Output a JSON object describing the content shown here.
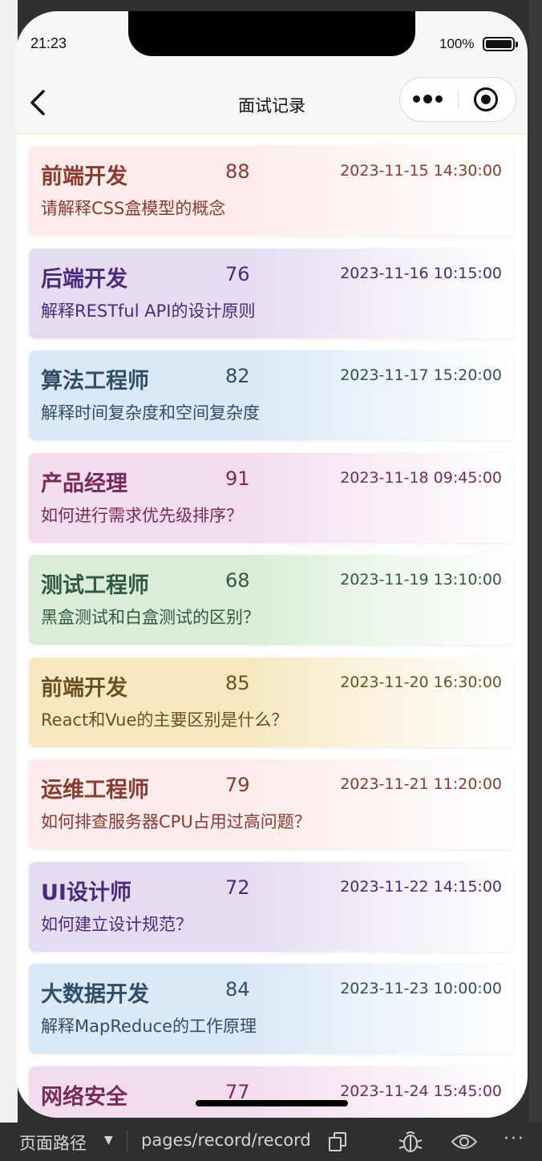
{
  "status_bar": {
    "time": "21:23",
    "battery": "100%",
    "battery_level": 1.0
  },
  "nav": {
    "title": "面试记录"
  },
  "records": [
    {
      "position": "前端开发",
      "score": "88",
      "date": "2023-11-15 14:30:00",
      "question": "请解释CSS盒模型的概念",
      "color": "#8b3a2e",
      "bg": "#fdeceb"
    },
    {
      "position": "后端开发",
      "score": "76",
      "date": "2023-11-16 10:15:00",
      "question": "解释RESTful API的设计原则",
      "color": "#4a2a7a",
      "bg": "#e6dcf2"
    },
    {
      "position": "算法工程师",
      "score": "82",
      "date": "2023-11-17 15:20:00",
      "question": "解释时间复杂度和空间复杂度",
      "color": "#2f4f66",
      "bg": "#dbe8f6"
    },
    {
      "position": "产品经理",
      "score": "91",
      "date": "2023-11-18 09:45:00",
      "question": "如何进行需求优先级排序？",
      "color": "#7a2a5a",
      "bg": "#f4dcef"
    },
    {
      "position": "测试工程师",
      "score": "68",
      "date": "2023-11-19 13:10:00",
      "question": "黑盒测试和白盒测试的区别？",
      "color": "#2e5a46",
      "bg": "#dbedd9"
    },
    {
      "position": "前端开发",
      "score": "85",
      "date": "2023-11-20 16:30:00",
      "question": "React和Vue的主要区别是什么？",
      "color": "#6a5220",
      "bg": "#f8e8c2"
    },
    {
      "position": "运维工程师",
      "score": "79",
      "date": "2023-11-21 11:20:00",
      "question": "如何排查服务器CPU占用过高问题？",
      "color": "#8b3a2e",
      "bg": "#fdeceb"
    },
    {
      "position": "UI设计师",
      "score": "72",
      "date": "2023-11-22 14:15:00",
      "question": "如何建立设计规范？",
      "color": "#4a2a7a",
      "bg": "#e6dcf2"
    },
    {
      "position": "大数据开发",
      "score": "84",
      "date": "2023-11-23 10:00:00",
      "question": "解释MapReduce的工作原理",
      "color": "#2f4f66",
      "bg": "#dbe8f6"
    },
    {
      "position": "网络安全",
      "score": "77",
      "date": "2023-11-24 15:45:00",
      "question": "",
      "color": "#7a2a5a",
      "bg": "#f4dcef"
    }
  ],
  "toolbar": {
    "path_label": "页面路径",
    "path": "pages/record/record"
  }
}
